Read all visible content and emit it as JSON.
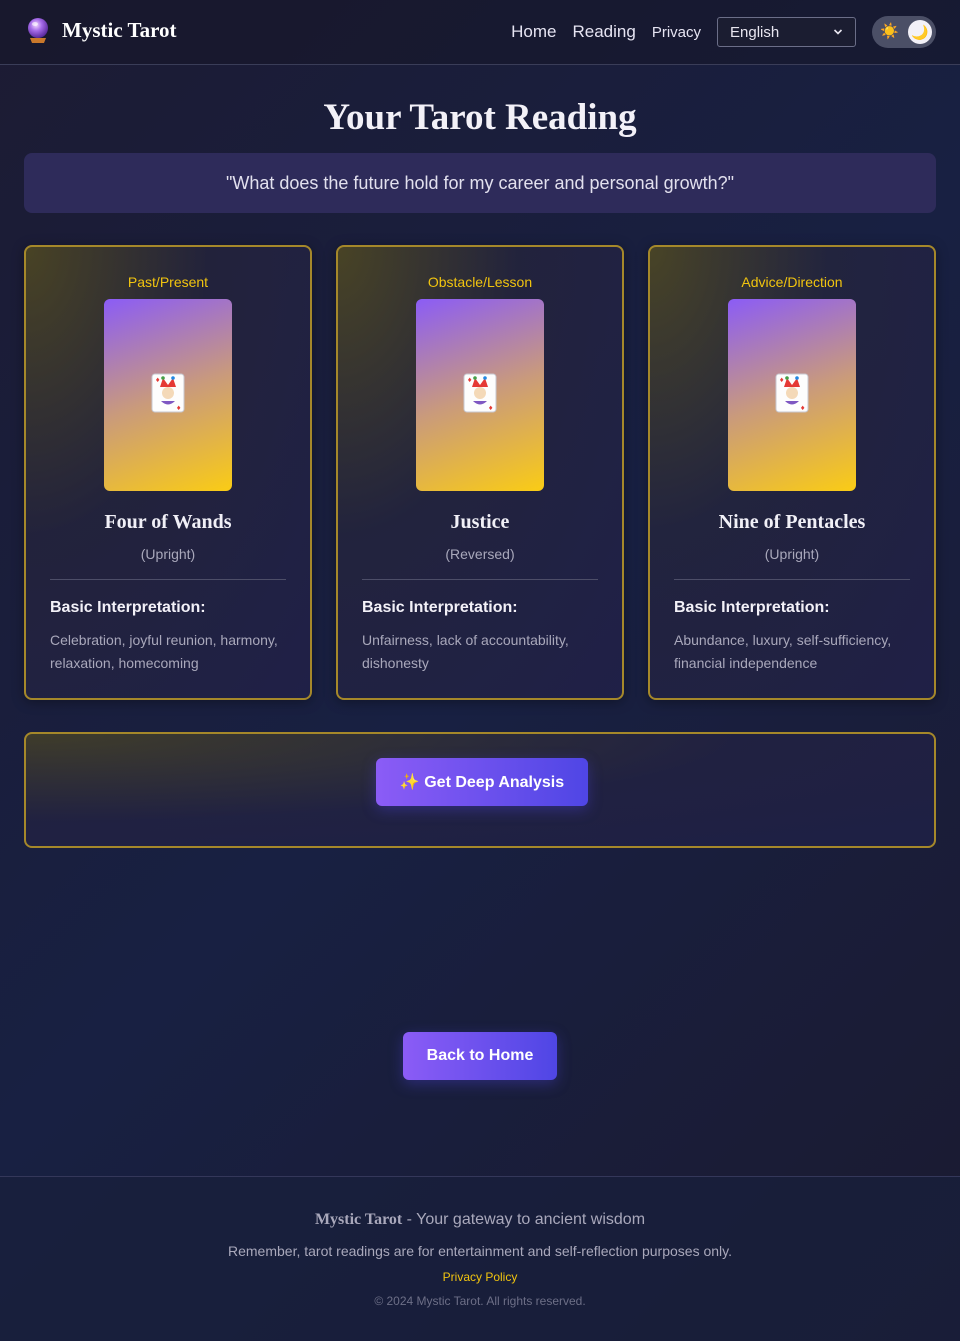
{
  "header": {
    "brand": "Mystic Tarot",
    "nav": {
      "home": "Home",
      "reading": "Reading",
      "privacy": "Privacy"
    },
    "language": "English",
    "theme_icons": {
      "light": "sun-icon",
      "dark": "moon-icon"
    }
  },
  "main": {
    "title": "Your Tarot Reading",
    "question": "\"What does the future hold for my career and personal growth?\"",
    "cards": [
      {
        "position": "Past/Present",
        "name": "Four of Wands",
        "orientation": "(Upright)",
        "interpretation_heading": "Basic Interpretation:",
        "interpretation": "Celebration, joyful reunion, harmony, relaxation, homecoming"
      },
      {
        "position": "Obstacle/Lesson",
        "name": "Justice",
        "orientation": "(Reversed)",
        "interpretation_heading": "Basic Interpretation:",
        "interpretation": "Unfairness, lack of accountability, dishonesty"
      },
      {
        "position": "Advice/Direction",
        "name": "Nine of Pentacles",
        "orientation": "(Upright)",
        "interpretation_heading": "Basic Interpretation:",
        "interpretation": "Abundance, luxury, self-sufficiency, financial independence"
      }
    ],
    "analysis_button": "✨ Get Deep Analysis",
    "back_button": "Back to Home"
  },
  "footer": {
    "brand": "Mystic Tarot",
    "tagline": " - Your gateway to ancient wisdom",
    "disclaimer": "Remember, tarot readings are for entertainment and self-reflection purposes only.",
    "privacy_link": "Privacy Policy",
    "copyright": "© 2024 Mystic Tarot. All rights reserved."
  },
  "colors": {
    "accent_gold": "#f1c40f",
    "card_border": "#a5882a",
    "button_start": "#8b5cf6",
    "button_end": "#4f46e5"
  },
  "icons": {
    "brand": "crystal-ball-icon",
    "card": "joker-card-icon",
    "dropdown": "chevron-down-icon"
  }
}
